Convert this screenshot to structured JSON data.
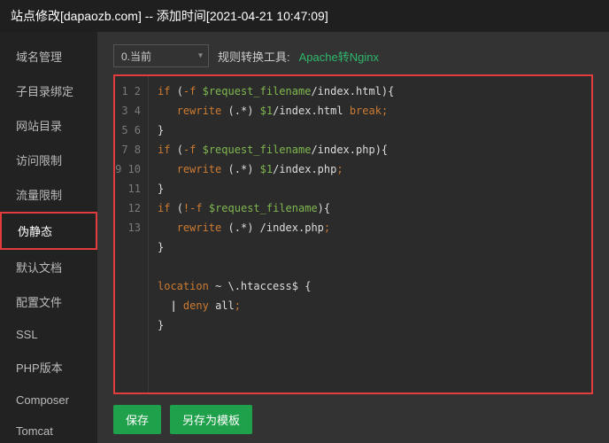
{
  "title": "站点修改[dapaozb.com] -- 添加时间[2021-04-21 10:47:09]",
  "sidebar": {
    "items": [
      {
        "label": "域名管理"
      },
      {
        "label": "子目录绑定"
      },
      {
        "label": "网站目录"
      },
      {
        "label": "访问限制"
      },
      {
        "label": "流量限制"
      },
      {
        "label": "伪静态",
        "active": true
      },
      {
        "label": "默认文档"
      },
      {
        "label": "配置文件"
      },
      {
        "label": "SSL"
      },
      {
        "label": "PHP版本"
      },
      {
        "label": "Composer"
      },
      {
        "label": "Tomcat"
      }
    ]
  },
  "toolbar": {
    "select_value": "0.当前",
    "tool_label": "规则转换工具:",
    "tool_link": "Apache转Nginx"
  },
  "editor": {
    "line_count": 13
  },
  "buttons": {
    "save": "保存",
    "save_as": "另存为模板"
  }
}
